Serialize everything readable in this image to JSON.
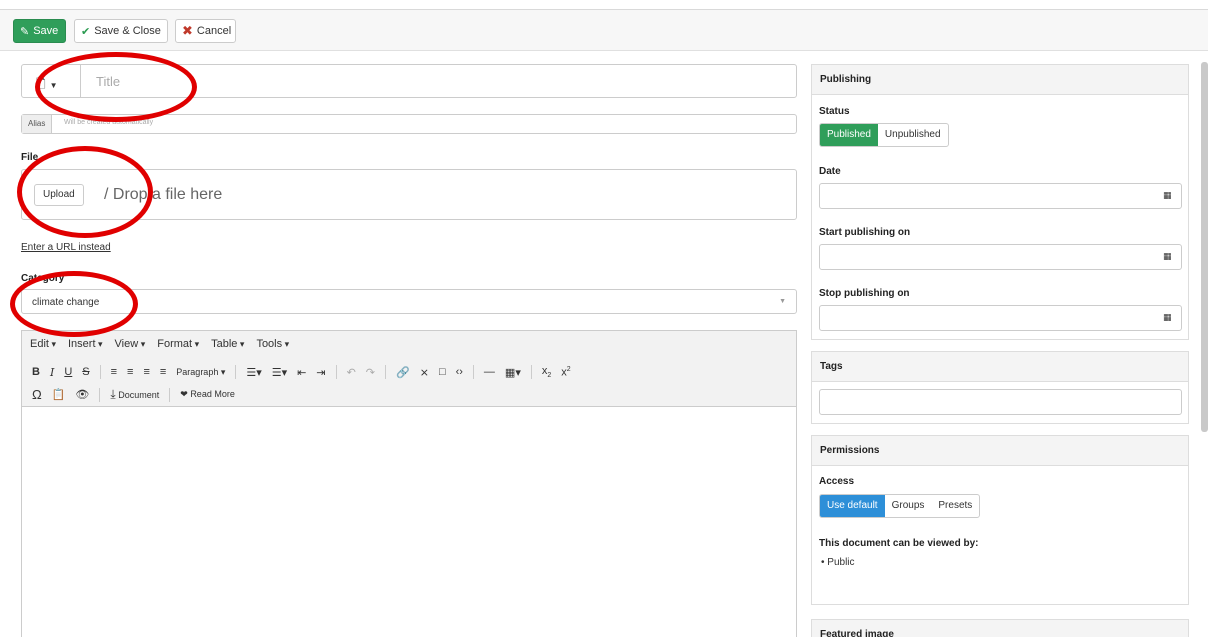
{
  "toolbar": {
    "save": "Save",
    "save_close": "Save & Close",
    "cancel": "Cancel"
  },
  "form": {
    "title_placeholder": "Title",
    "alias_label": "Alias",
    "alias_placeholder": "Will be created automatically",
    "file_label": "File",
    "upload_button": "Upload",
    "drop_text": "/  Drop a file here",
    "url_link": "Enter a URL instead",
    "category_label": "Category",
    "category_value": "climate change"
  },
  "editor": {
    "menus": [
      "Edit",
      "Insert",
      "View",
      "Format",
      "Table",
      "Tools"
    ],
    "paragraph": "Paragraph",
    "document_button": "Document",
    "read_more_button": "Read More"
  },
  "sidebar": {
    "publishing": {
      "title": "Publishing",
      "status_label": "Status",
      "status_options": [
        "Published",
        "Unpublished"
      ],
      "date_label": "Date",
      "start_label": "Start publishing on",
      "stop_label": "Stop publishing on"
    },
    "tags": {
      "title": "Tags"
    },
    "permissions": {
      "title": "Permissions",
      "access_label": "Access",
      "access_options": [
        "Use default",
        "Groups",
        "Presets"
      ],
      "viewed_by_label": "This document can be viewed by:",
      "viewers": [
        "Public"
      ]
    },
    "featured_image": {
      "title": "Featured image"
    }
  },
  "colors": {
    "save_green": "#2f9e5a",
    "selected_blue": "#2d8fd8",
    "annotation_red": "#e00000"
  }
}
